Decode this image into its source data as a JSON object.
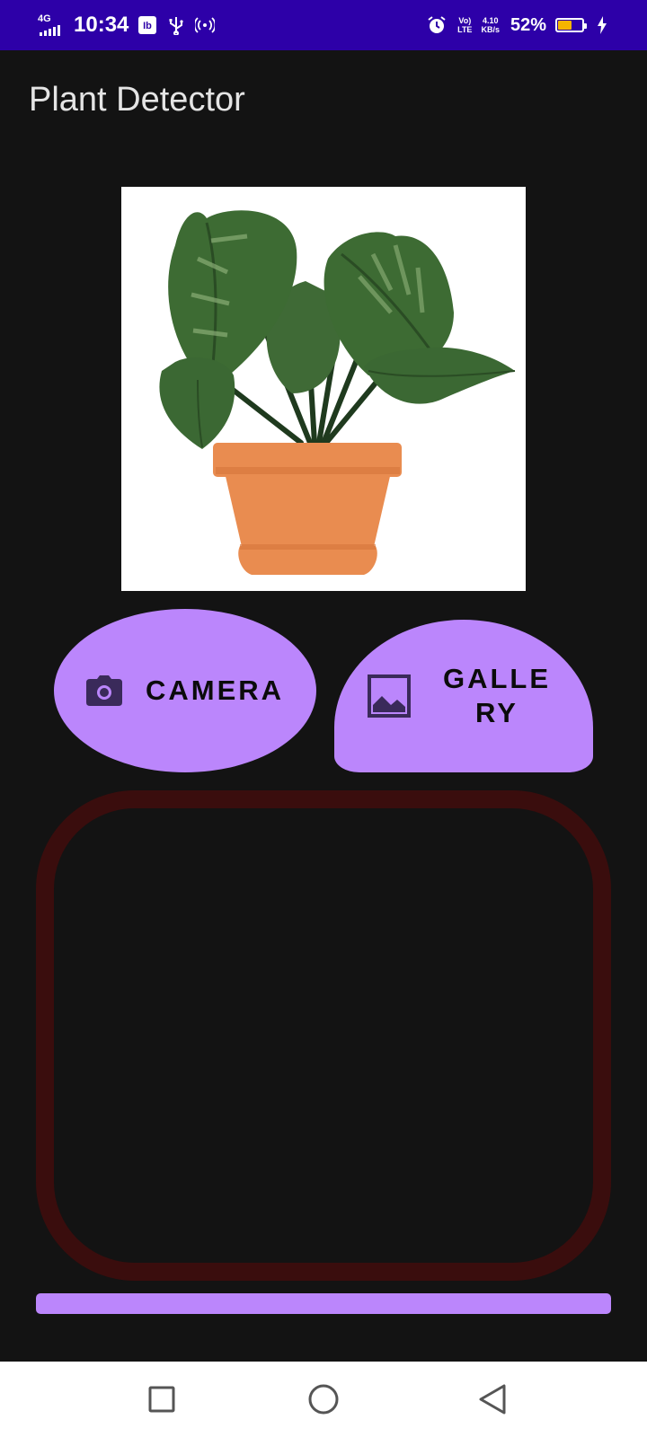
{
  "status_bar": {
    "network": "4G",
    "time": "10:34",
    "volte_line1": "Vo)",
    "volte_line2": "LTE",
    "speed_value": "4.10",
    "speed_unit": "KB/s",
    "battery_percent": "52%",
    "battery_level": 0.52,
    "icons": [
      "signal-icon",
      "usb-debug-icon",
      "usb-icon",
      "hotspot-icon",
      "alarm-icon",
      "battery-icon",
      "charging-icon"
    ]
  },
  "app": {
    "title": "Plant Detector"
  },
  "preview": {
    "image": "potted-plant-image"
  },
  "buttons": {
    "camera_label": "CAMERA",
    "gallery_label": "GALLERY",
    "camera_icon": "camera-icon",
    "gallery_icon": "image-icon"
  },
  "colors": {
    "status_bar": "#2d00a8",
    "background": "#131313",
    "accent": "#bb86fc",
    "result_border": "#3a0d0d"
  },
  "navigation_bar": {
    "icons": [
      "recent-apps-icon",
      "home-icon",
      "back-icon"
    ]
  }
}
